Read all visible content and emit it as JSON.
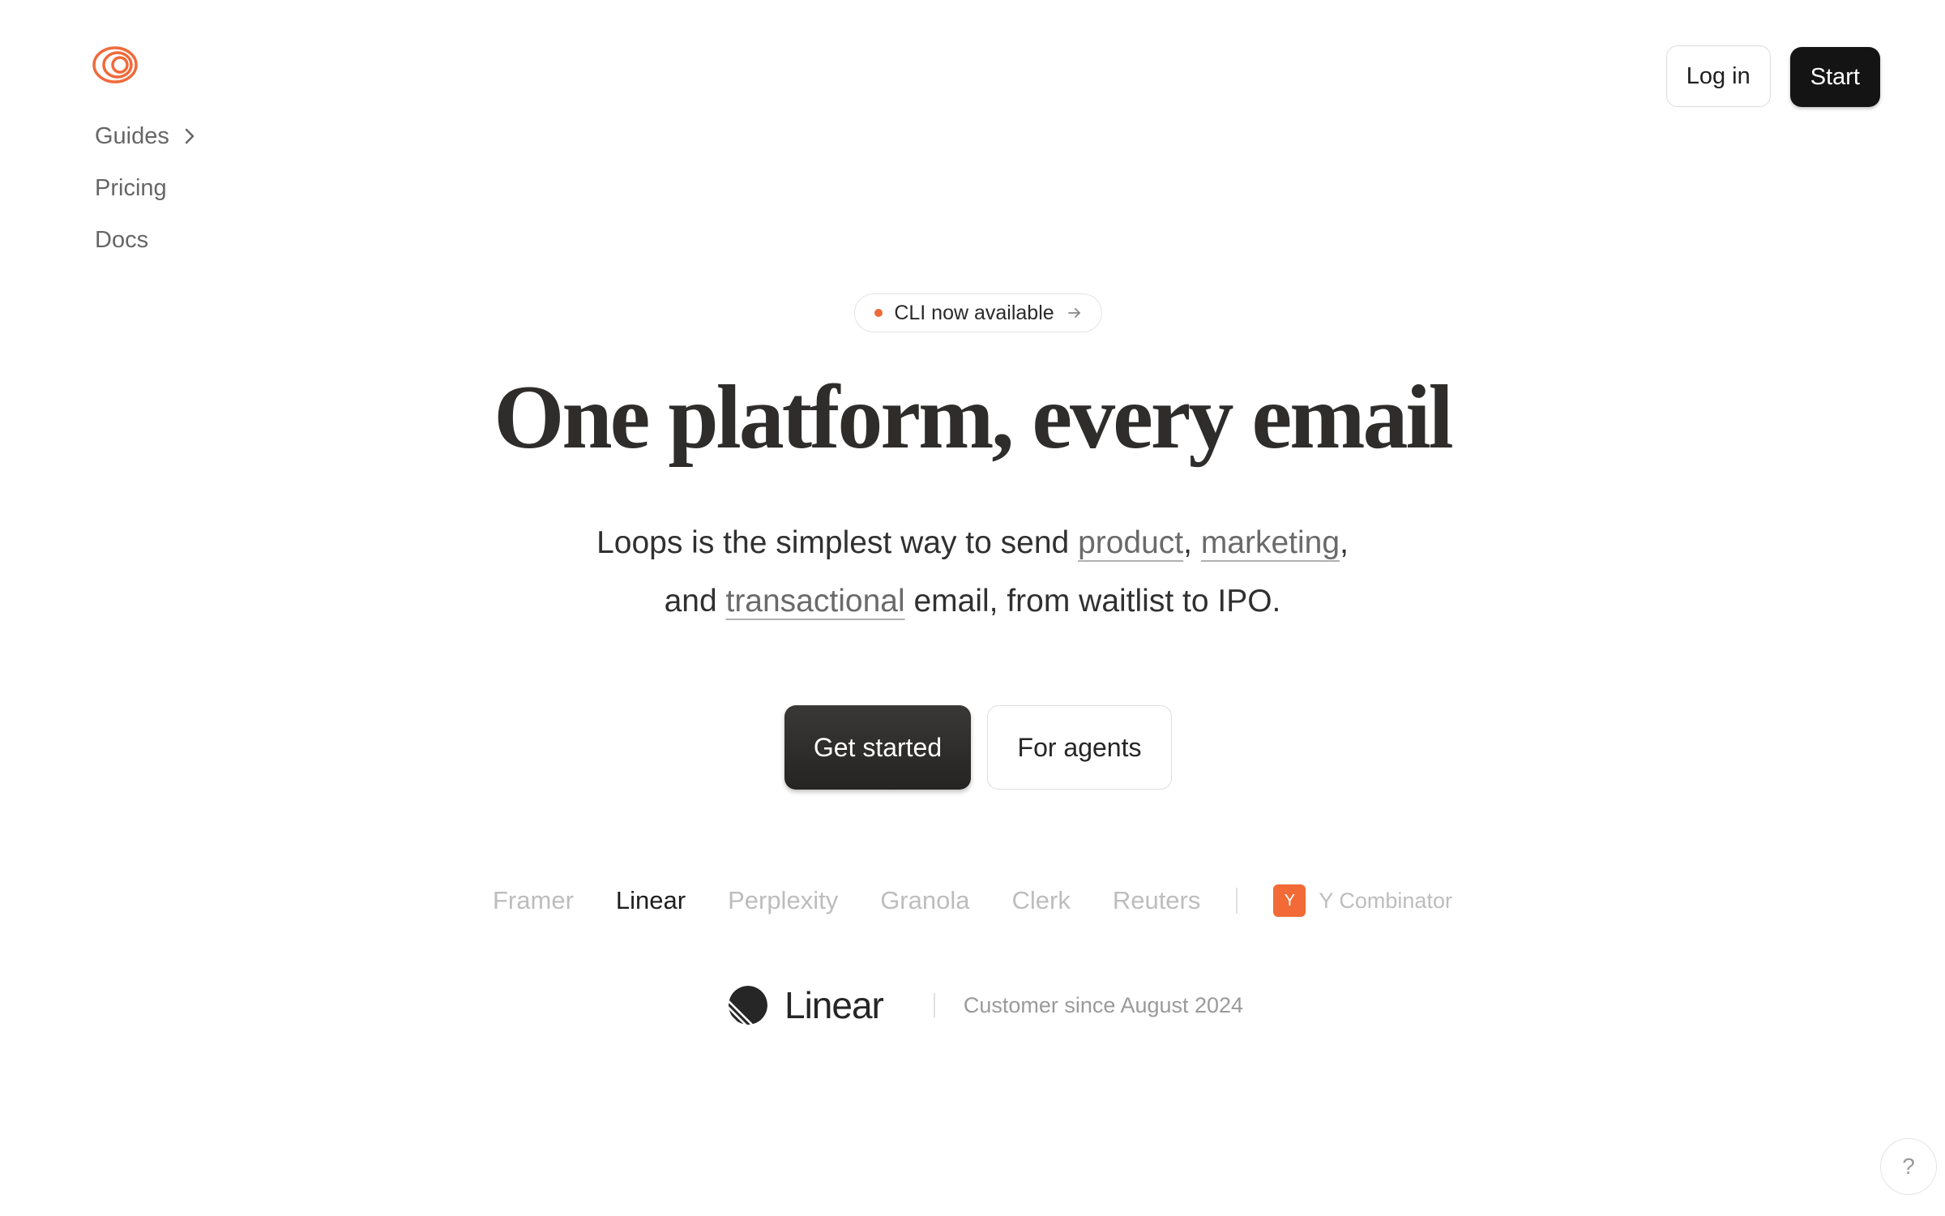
{
  "brand": {
    "accent_color": "#f06a3a",
    "logo_icon": "loops-rings-icon"
  },
  "nav": {
    "items": [
      {
        "label": "Guides",
        "icon": "chevron-right-icon"
      },
      {
        "label": "Pricing"
      },
      {
        "label": "Docs"
      }
    ]
  },
  "header": {
    "login_label": "Log in",
    "start_label": "Start"
  },
  "announcement": {
    "text": "CLI now available",
    "icon": "arrow-right-icon"
  },
  "hero": {
    "title": "One platform, every email",
    "subtitle": {
      "part1": "Loops is the simplest way to send ",
      "link1": "product",
      "sep1": ", ",
      "link2": "marketing",
      "sep2": ",",
      "part2": "and ",
      "link3": "transactional",
      "part3": " email, from waitlist to IPO."
    }
  },
  "cta": {
    "primary_label": "Get started",
    "secondary_label": "For agents"
  },
  "customers": {
    "logos": [
      "Framer",
      "Linear",
      "Perplexity",
      "Granola",
      "Clerk",
      "Reuters"
    ],
    "active_logo": "Linear",
    "yc_badge": "Y",
    "yc_label": "Y Combinator"
  },
  "featured": {
    "name": "Linear",
    "since": "Customer since August 2024"
  },
  "help": {
    "label": "?"
  }
}
